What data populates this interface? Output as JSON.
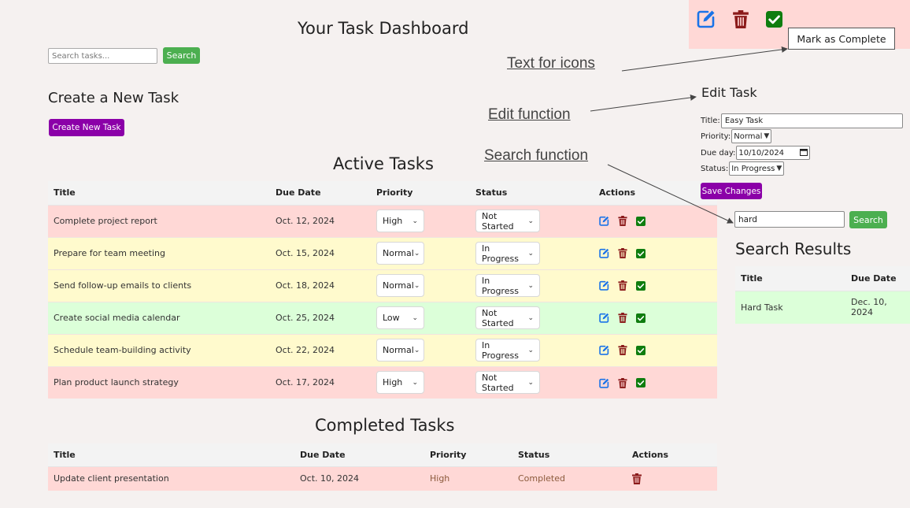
{
  "page": {
    "title": "Your Task Dashboard",
    "search_placeholder": "Search tasks...",
    "search_button": "Search"
  },
  "create": {
    "heading": "Create a New Task",
    "button": "Create New Task"
  },
  "active": {
    "heading": "Active Tasks",
    "columns": [
      "Title",
      "Due Date",
      "Priority",
      "Status",
      "Actions"
    ],
    "rows": [
      {
        "title": "Complete project report",
        "due": "Oct. 12, 2024",
        "priority": "High",
        "status": "Not Started",
        "color": "#ffd8d6"
      },
      {
        "title": "Prepare for team meeting",
        "due": "Oct. 15, 2024",
        "priority": "Normal",
        "status": "In Progress",
        "color": "#fffacd"
      },
      {
        "title": "Send follow-up emails to clients",
        "due": "Oct. 18, 2024",
        "priority": "Normal",
        "status": "In Progress",
        "color": "#fffacd"
      },
      {
        "title": "Create social media calendar",
        "due": "Oct. 25, 2024",
        "priority": "Low",
        "status": "Not Started",
        "color": "#dcffd9"
      },
      {
        "title": "Schedule team-building activity",
        "due": "Oct. 22, 2024",
        "priority": "Normal",
        "status": "In Progress",
        "color": "#fffacd"
      },
      {
        "title": "Plan product launch strategy",
        "due": "Oct. 17, 2024",
        "priority": "High",
        "status": "Not Started",
        "color": "#ffd8d6"
      }
    ]
  },
  "completed": {
    "heading": "Completed Tasks",
    "columns": [
      "Title",
      "Due Date",
      "Priority",
      "Status",
      "Actions"
    ],
    "rows": [
      {
        "title": "Update client presentation",
        "due": "Oct. 10, 2024",
        "priority": "High",
        "status": "Completed"
      }
    ]
  },
  "icons_demo": {
    "tooltip": "Mark as Complete",
    "icons": [
      "edit-icon",
      "trash-icon",
      "check-icon"
    ]
  },
  "annotations": {
    "icons_note": "Text for icons",
    "edit_note": "Edit function",
    "search_note": "Search function"
  },
  "edit_task": {
    "heading": "Edit Task",
    "title_label": "Title:",
    "title_value": "Easy Task",
    "priority_label": "Priority:",
    "priority_value": "Normal",
    "due_label": "Due day:",
    "due_value": "10/10/2024",
    "status_label": "Status:",
    "status_value": "In Progress",
    "save_button": "Save Changes"
  },
  "search_demo": {
    "query": "hard",
    "button": "Search",
    "heading": "Search Results",
    "columns": [
      "Title",
      "Due Date"
    ],
    "rows": [
      {
        "title": "Hard Task",
        "due": "Dec. 10, 2024"
      }
    ]
  },
  "colors": {
    "edit": "#1a73e8",
    "trash": "#8b1a1a",
    "check": "#1f8f1f",
    "purple": "#8b00a8",
    "green_button": "#4caf50"
  }
}
